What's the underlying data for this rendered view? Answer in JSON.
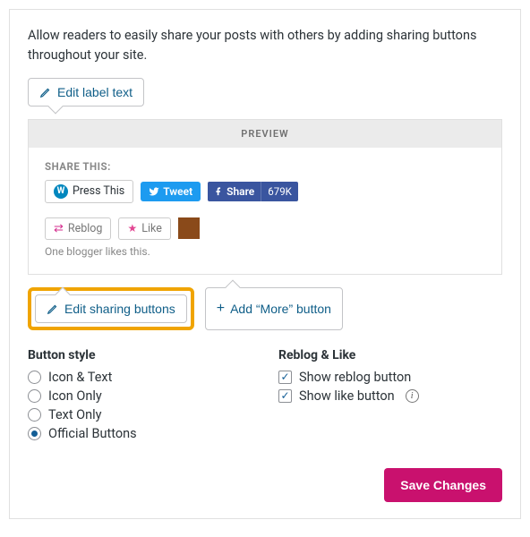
{
  "intro": "Allow readers to easily share your posts with others by adding sharing buttons throughout your site.",
  "editLabel": "Edit label text",
  "preview": {
    "header": "PREVIEW",
    "shareLabel": "SHARE THIS:",
    "pressThis": "Press This",
    "tweet": "Tweet",
    "fbShare": "Share",
    "fbCount": "679K",
    "reblog": "Reblog",
    "like": "Like",
    "likesText": "One blogger likes this."
  },
  "actions": {
    "editSharing": "Edit sharing buttons",
    "addMore": "Add “More” button"
  },
  "buttonStyle": {
    "title": "Button style",
    "options": [
      "Icon & Text",
      "Icon Only",
      "Text Only",
      "Official Buttons"
    ],
    "selected": 3
  },
  "reblogLike": {
    "title": "Reblog & Like",
    "showReblog": "Show reblog button",
    "showLike": "Show like button"
  },
  "save": "Save Changes"
}
